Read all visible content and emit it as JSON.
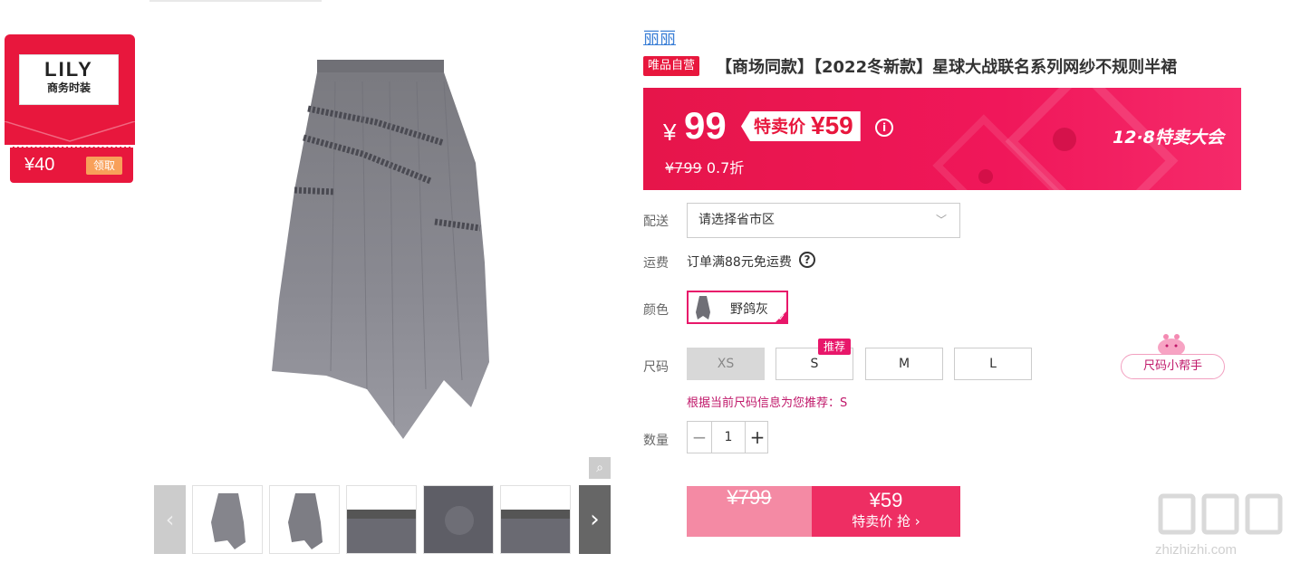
{
  "coupon": {
    "brand_line1": "LILY",
    "brand_line2": "商务时装",
    "amount": "¥40",
    "claim_label": "领取"
  },
  "product": {
    "brand": "丽丽",
    "self_op_tag": "唯品自营",
    "title": "【商场同款】【2022冬新款】星球大战联名系列网纱不规则半裙"
  },
  "price": {
    "currency": "¥",
    "price": "99",
    "special_label": "特卖价",
    "special_price": "¥59",
    "info_icon": "info-icon",
    "original": "¥799",
    "discount": "0.7折",
    "event": "12·8特卖大会"
  },
  "delivery": {
    "label": "配送",
    "placeholder": "请选择省市区"
  },
  "shipping": {
    "label": "运费",
    "text": "订单满88元免运费"
  },
  "color": {
    "label": "颜色",
    "selected": "野鸽灰"
  },
  "size": {
    "label": "尺码",
    "options": [
      {
        "label": "XS",
        "disabled": true
      },
      {
        "label": "S",
        "recommended": true
      },
      {
        "label": "M"
      },
      {
        "label": "L"
      }
    ],
    "recommend_badge": "推荐",
    "recommend_text": "根据当前尺码信息为您推荐：S",
    "helper_label": "尺码小帮手"
  },
  "quantity": {
    "label": "数量",
    "minus": "−",
    "value": "1",
    "plus": "+"
  },
  "buy": {
    "original": "¥799",
    "price": "¥59",
    "action": "特卖价 抢 ›"
  },
  "gallery": {
    "prev": "‹",
    "next": "›",
    "zoom_icon": "magnifier-icon"
  },
  "colors": {
    "accent": "#e8173d",
    "pink": "#e8176a",
    "brand_link": "#3b7fd6"
  }
}
